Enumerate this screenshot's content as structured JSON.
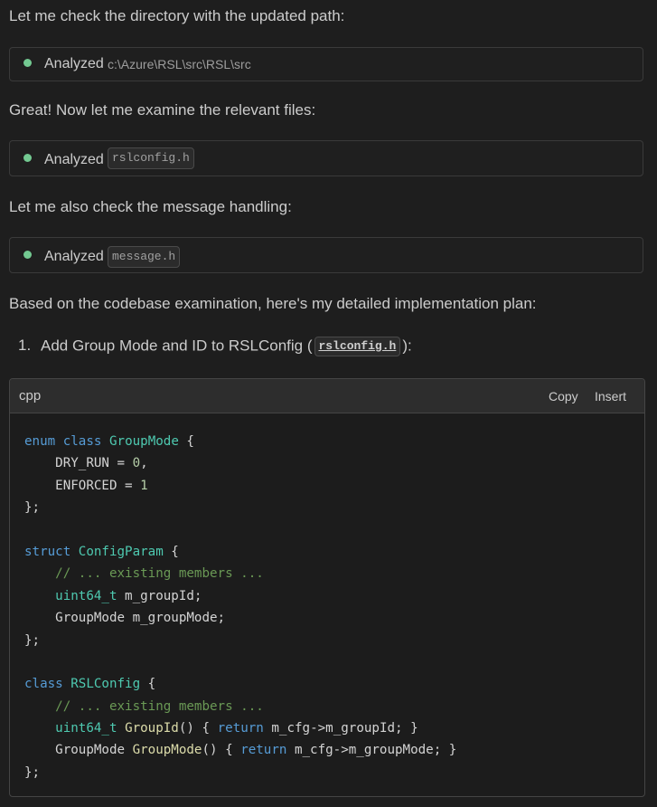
{
  "messages": {
    "check_directory": "Let me check the directory with the updated path:",
    "examine_files": "Great! Now let me examine the relevant files:",
    "check_message": "Let me also check the message handling:",
    "plan_intro": "Based on the codebase examination, here's my detailed implementation plan:"
  },
  "analyzed_cards": [
    {
      "label": "Analyzed",
      "path": "c:\\Azure\\RSL\\src\\RSL\\src"
    },
    {
      "label": "Analyzed",
      "file": "rslconfig.h"
    },
    {
      "label": "Analyzed",
      "file": "message.h"
    }
  ],
  "plan_list": {
    "item1_number": "1.",
    "item1_text": "Add Group Mode and ID to RSLConfig (",
    "item1_file": "rslconfig.h",
    "item1_suffix": "):"
  },
  "code_block": {
    "language": "cpp",
    "copy_label": "Copy",
    "insert_label": "Insert",
    "lines": [
      "enum class GroupMode {",
      "    DRY_RUN = 0,",
      "    ENFORCED = 1",
      "};",
      "",
      "struct ConfigParam {",
      "    // ... existing members ...",
      "    uint64_t m_groupId;",
      "    GroupMode m_groupMode;",
      "};",
      "",
      "class RSLConfig {",
      "    // ... existing members ...",
      "    uint64_t GroupId() { return m_cfg->m_groupId; }",
      "    GroupMode GroupMode() { return m_cfg->m_groupMode; }",
      "};"
    ]
  },
  "colors": {
    "background": "#1e1e1e",
    "status_dot": "#73c991",
    "keyword": "#569cd6",
    "type": "#4ec9b0",
    "number": "#b5cea8",
    "comment": "#6a9955",
    "function": "#dcdcaa"
  }
}
